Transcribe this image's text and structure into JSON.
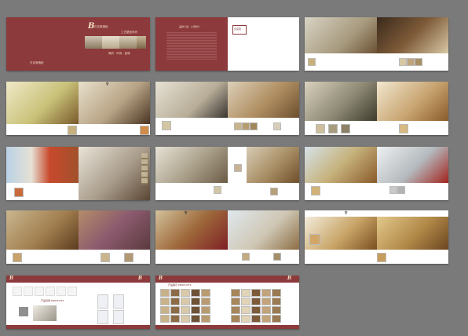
{
  "cover": {
    "logo": "B",
    "logo_sub": "贝克曼墙纸",
    "series_title": "工艺壁纸系列",
    "tagline": "简约 · 时尚 · 品味"
  },
  "intro": {
    "heading": "品牌介绍 · 公司简介",
    "stamp": "贝克曼"
  },
  "catalog_spread": {
    "logo": "B",
    "band_text": "产品目录 PRODUCTS"
  },
  "swatch_spread": {
    "logo": "B",
    "band_text": "产品展示 PRODUCTS"
  },
  "colors": {
    "maroon": "#8c3a3c",
    "background": "#7a7a7a",
    "page": "#ffffff"
  }
}
